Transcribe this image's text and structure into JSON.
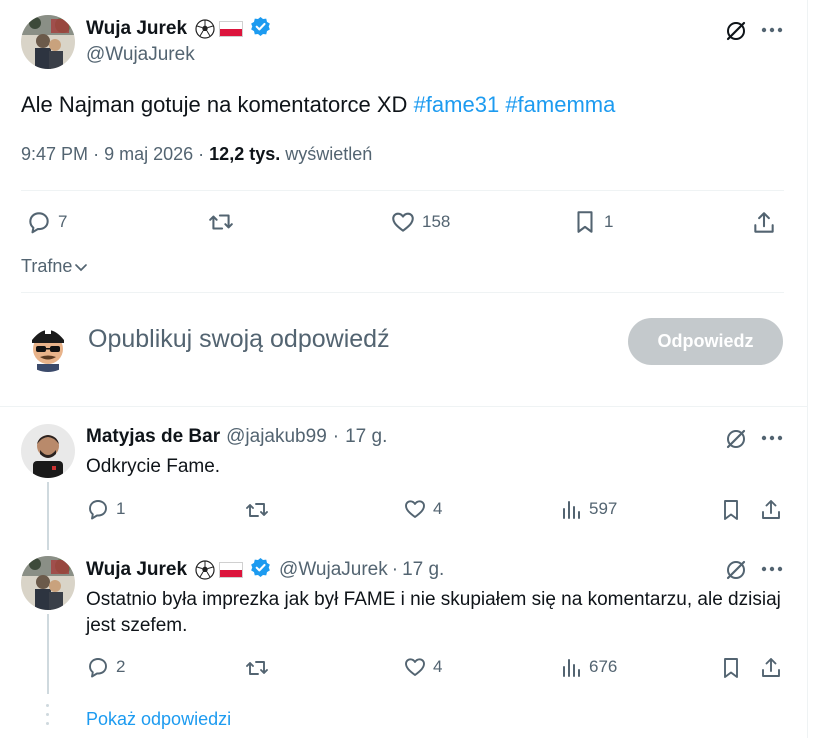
{
  "main_tweet": {
    "author_name": "Wuja Jurek",
    "author_handle": "@WujaJurek",
    "text_prefix": "Ale Najman gotuje na komentatorce XD",
    "hashtags": [
      "#fame31",
      "#famemma"
    ],
    "time": "9:47 PM",
    "sep1": "·",
    "date": "9 maj 2026",
    "sep2": "·",
    "views_count": "12,2 tys.",
    "views_label": "wyświetleń",
    "replies": "7",
    "reposts": "",
    "likes": "158",
    "bookmarks": "1"
  },
  "sort": {
    "label": "Trafne"
  },
  "compose": {
    "placeholder": "Opublikuj swoją odpowiedź",
    "button": "Odpowiedz"
  },
  "replies": [
    {
      "author_name": "Matyjas de Bar",
      "author_handle": "@jajakub99",
      "sep": "·",
      "time_ago": "17 g.",
      "text": "Odkrycie Fame.",
      "replies": "1",
      "likes": "4",
      "views": "597"
    },
    {
      "author_name": "Wuja Jurek",
      "author_handle": "@WujaJurek",
      "sep": "·",
      "time_ago": "17 g.",
      "text": "Ostatnio była imprezka jak był FAME i nie skupiałem się na komentarzu, ale dzisiaj jest szefem.",
      "replies": "2",
      "likes": "4",
      "views": "676"
    }
  ],
  "show_replies": "Pokaż odpowiedzi",
  "colors": {
    "accent": "#1d9bf0",
    "muted": "#536471",
    "flag_red": "#dc143c",
    "button_disabled": "#c4c9cc"
  }
}
